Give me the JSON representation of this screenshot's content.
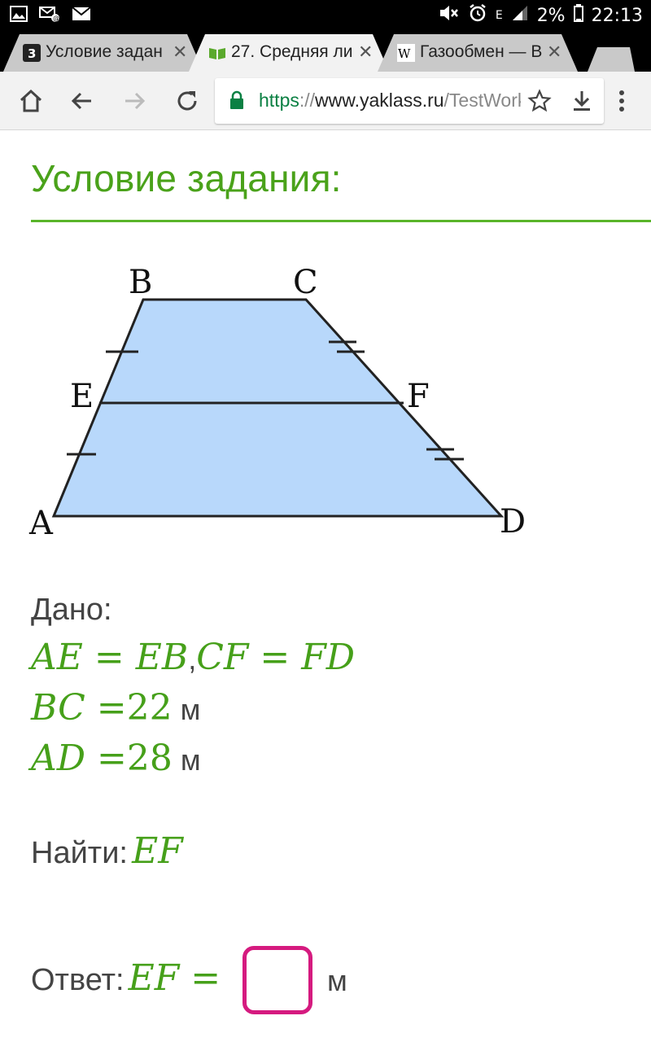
{
  "status_bar": {
    "battery": "2%",
    "time": "22:13",
    "network_label": "E"
  },
  "tabs": [
    {
      "title": "Условие задан",
      "favicon": "yaklass-favicon",
      "active": false
    },
    {
      "title": "27. Средняя ли",
      "favicon": "book-icon",
      "active": true
    },
    {
      "title": "Газообмен — В",
      "favicon": "wikipedia-icon",
      "active": false
    }
  ],
  "toolbar": {
    "url_scheme": "https",
    "url_sep": "://",
    "url_host": "www.yaklass.ru",
    "url_path": "/TestWork"
  },
  "content": {
    "heading": "Условие задания:",
    "figure_labels": {
      "A": "A",
      "B": "B",
      "C": "C",
      "D": "D",
      "E": "E",
      "F": "F"
    },
    "given_label": "Дано:",
    "given_eq1_left": "AE = EB",
    "given_eq1_sep": ",",
    "given_eq1_right": "CF = FD",
    "given_bc_var": "BC =",
    "given_bc_value": "22",
    "given_ad_var": "AD =",
    "given_ad_value": "28",
    "unit": "м",
    "find_label": "Найти:",
    "find_var": "EF",
    "answer_label": "Ответ:",
    "answer_var": "EF =",
    "answer_value": ""
  },
  "colors": {
    "accent_green": "#4aa21a",
    "trapezoid_fill": "#b8d8fb",
    "answer_border": "#d51a7f"
  }
}
